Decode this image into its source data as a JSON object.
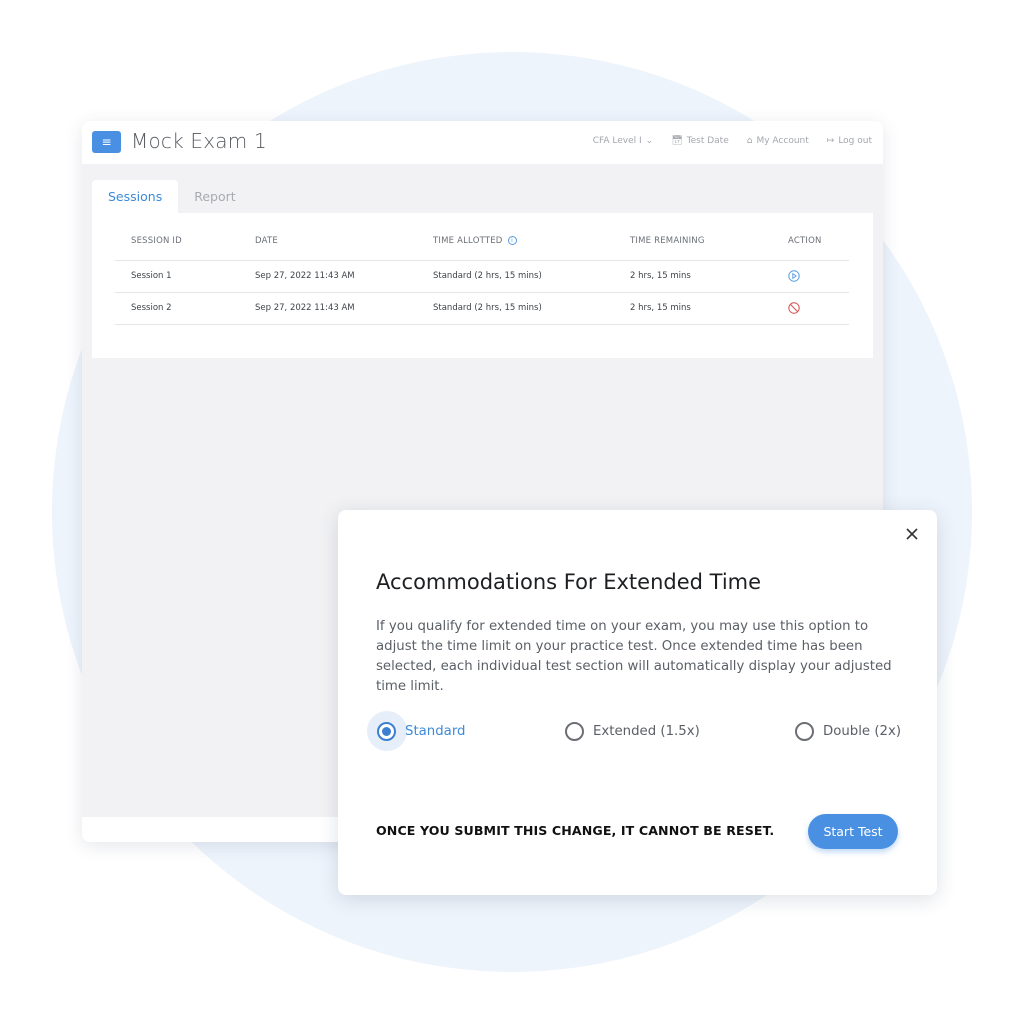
{
  "app": {
    "title": "Mock Exam 1",
    "menu_icon": "hamburger-menu-icon",
    "nav": [
      {
        "label": "CFA Level I",
        "icon": "chevron-down-icon"
      },
      {
        "label": "Test Date",
        "icon": "calendar-icon"
      },
      {
        "label": "My Account",
        "icon": "home-icon"
      },
      {
        "label": "Log out",
        "icon": "logout-icon"
      }
    ]
  },
  "tabs": [
    {
      "label": "Sessions",
      "active": true
    },
    {
      "label": "Report",
      "active": false
    }
  ],
  "table": {
    "columns": [
      "SESSION ID",
      "DATE",
      "TIME ALLOTTED",
      "TIME REMAINING",
      "ACTION"
    ],
    "rows": [
      {
        "session_id": "Session 1",
        "date": "Sep 27, 2022 11:43 AM",
        "time_allotted": "Standard (2 hrs, 15 mins)",
        "time_remaining": "2 hrs, 15 mins",
        "action": "play-icon"
      },
      {
        "session_id": "Session 2",
        "date": "Sep 27, 2022 11:43 AM",
        "time_allotted": "Standard (2 hrs, 15 mins)",
        "time_remaining": "2 hrs, 15 mins",
        "action": "blocked-icon"
      }
    ]
  },
  "modal": {
    "title": "Accommodations For Extended Time",
    "description": "If you qualify for extended time on your exam, you may use this option to adjust the time limit on your practice test. Once extended time has been selected, each individual test section will automatically display your adjusted time limit.",
    "options": [
      {
        "label": "Standard",
        "selected": true
      },
      {
        "label": "Extended (1.5x)",
        "selected": false
      },
      {
        "label": "Double (2x)",
        "selected": false
      }
    ],
    "warning": "ONCE YOU SUBMIT THIS CHANGE, IT CANNOT BE RESET.",
    "submit_label": "Start Test"
  },
  "colors": {
    "accent": "#4a90e2",
    "tab_active": "#3c8ad8",
    "blocked": "#d9534f",
    "background_circle": "#eef4fc"
  }
}
